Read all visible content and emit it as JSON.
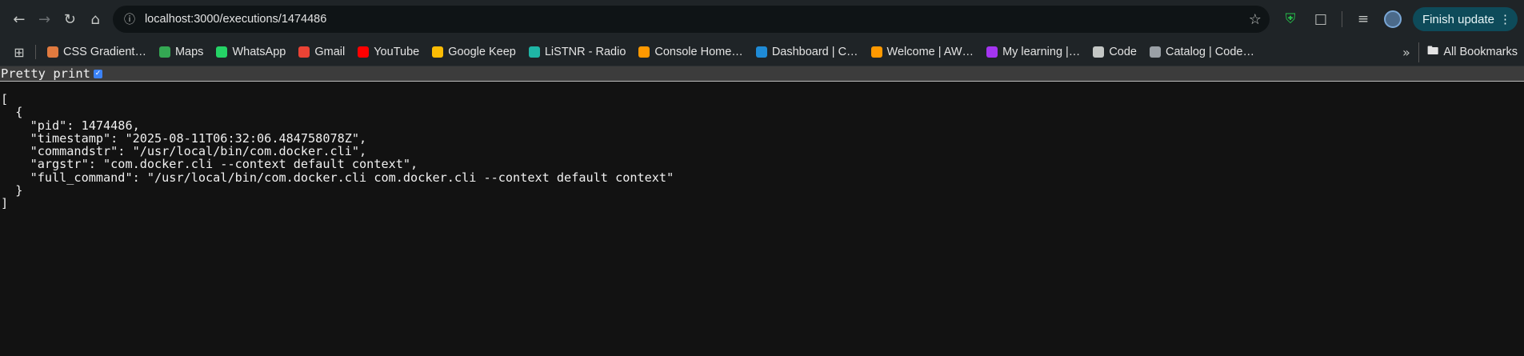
{
  "browser": {
    "url": "localhost:3000/executions/1474486",
    "finish_update_label": "Finish update"
  },
  "bookmarks": [
    {
      "label": "CSS Gradient…",
      "color": "#e07a3f"
    },
    {
      "label": "Maps",
      "color": "#34a853"
    },
    {
      "label": "WhatsApp",
      "color": "#25d366"
    },
    {
      "label": "Gmail",
      "color": "#ea4335"
    },
    {
      "label": "YouTube",
      "color": "#ff0000"
    },
    {
      "label": "Google Keep",
      "color": "#fbbc04"
    },
    {
      "label": "LiSTNR - Radio",
      "color": "#1fb6a6"
    },
    {
      "label": "Console Home…",
      "color": "#ff9900"
    },
    {
      "label": "Dashboard | C…",
      "color": "#1f8bd6"
    },
    {
      "label": "Welcome | AW…",
      "color": "#ff9900"
    },
    {
      "label": "My learning |…",
      "color": "#a435f0"
    },
    {
      "label": "Code",
      "color": "#c4c7c5"
    },
    {
      "label": "Catalog | Code…",
      "color": "#9aa0a6"
    }
  ],
  "all_bookmarks_label": "All Bookmarks",
  "pretty_print": {
    "label": "Pretty print",
    "checked": true
  },
  "json_lines": [
    "[",
    "  {",
    "    \"pid\": 1474486,",
    "    \"timestamp\": \"2025-08-11T06:32:06.484758078Z\",",
    "    \"commandstr\": \"/usr/local/bin/com.docker.cli\",",
    "    \"argstr\": \"com.docker.cli --context default context\",",
    "    \"full_command\": \"/usr/local/bin/com.docker.cli com.docker.cli --context default context\"",
    "  }",
    "]"
  ]
}
